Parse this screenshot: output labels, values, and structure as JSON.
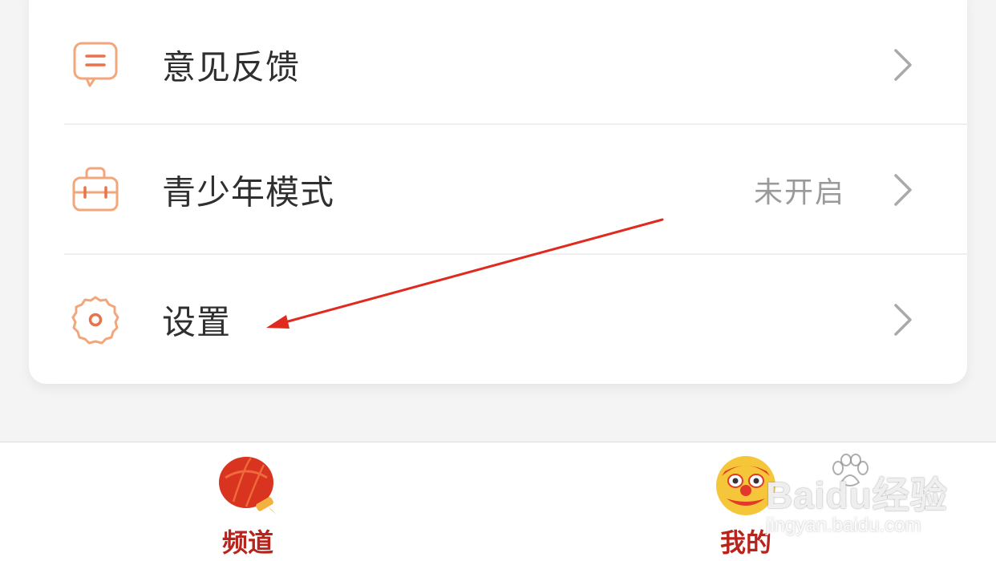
{
  "menu": {
    "items": [
      {
        "label": "意见反馈",
        "icon": "feedback-icon",
        "status": ""
      },
      {
        "label": "青少年模式",
        "icon": "teen-mode-icon",
        "status": "未开启"
      },
      {
        "label": "设置",
        "icon": "settings-gear-icon",
        "status": ""
      }
    ]
  },
  "tabbar": {
    "tabs": [
      {
        "label": "频道",
        "icon": "lantern-icon"
      },
      {
        "label": "我的",
        "icon": "lion-dance-avatar-icon"
      }
    ]
  },
  "watermark": {
    "brand": "Baidu经验",
    "url": "jingyan.baidu.com"
  },
  "colors": {
    "icon_accent": "#f2a67a",
    "icon_accent_dark": "#e8734a",
    "tab_label": "#b8231c",
    "annotation_arrow": "#e02a1e",
    "status_text": "#9a9a9a"
  }
}
